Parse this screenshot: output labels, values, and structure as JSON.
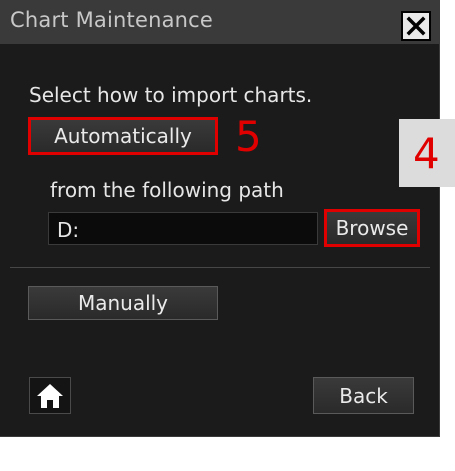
{
  "dialog": {
    "title": "Chart Maintenance",
    "instruction": "Select how to import charts.",
    "automatically_label": "Automatically",
    "path_caption": "from the following path",
    "path_value": "D:",
    "browse_label": "Browse",
    "manually_label": "Manually",
    "back_label": "Back"
  },
  "annotations": {
    "five": "5",
    "four": "4"
  },
  "icons": {
    "close": "close-icon",
    "home": "home-icon"
  },
  "colors": {
    "highlight_red": "#e10000",
    "dialog_bg": "#1b1b1b",
    "titlebar_bg": "#3a3a3a"
  }
}
